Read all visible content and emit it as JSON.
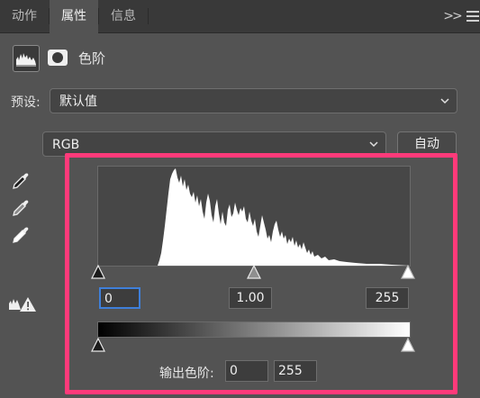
{
  "tabs": [
    {
      "label": "动作",
      "active": false
    },
    {
      "label": "属性",
      "active": true
    },
    {
      "label": "信息",
      "active": false
    }
  ],
  "panel": {
    "title": "色阶",
    "preset_label": "预设:",
    "preset_value": "默认值",
    "channel_value": "RGB",
    "auto_label": "自动"
  },
  "input_levels": {
    "black": "0",
    "gamma": "1.00",
    "white": "255"
  },
  "output_levels": {
    "label": "输出色阶:",
    "black": "0",
    "white": "255"
  },
  "icons": [
    "collapse-icon",
    "panel-menu-icon",
    "histogram-icon",
    "mask-icon",
    "chevron-down-icon",
    "black-eyedropper-icon",
    "gray-eyedropper-icon",
    "white-eyedropper-icon",
    "clipping-warning-icon"
  ],
  "colors": {
    "highlight": "#ff3a7a",
    "focus": "#3f7fd9",
    "panel_bg": "#535353"
  }
}
